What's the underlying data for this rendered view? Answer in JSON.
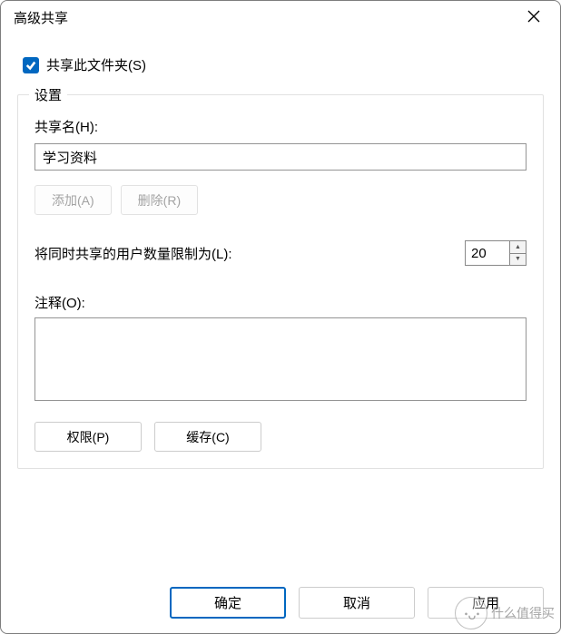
{
  "window": {
    "title": "高级共享"
  },
  "share": {
    "checkbox_label": "共享此文件夹(S)",
    "checked": true
  },
  "settings": {
    "legend": "设置",
    "share_name_label": "共享名(H):",
    "share_name_value": "学习资料",
    "add_btn": "添加(A)",
    "remove_btn": "删除(R)",
    "limit_label": "将同时共享的用户数量限制为(L):",
    "limit_value": "20",
    "comment_label": "注释(O):",
    "comment_value": "",
    "permissions_btn": "权限(P)",
    "cache_btn": "缓存(C)"
  },
  "footer": {
    "ok": "确定",
    "cancel": "取消",
    "apply": "应用"
  },
  "watermark": {
    "logo": "･ᴗ･",
    "text": "什么值得买"
  }
}
